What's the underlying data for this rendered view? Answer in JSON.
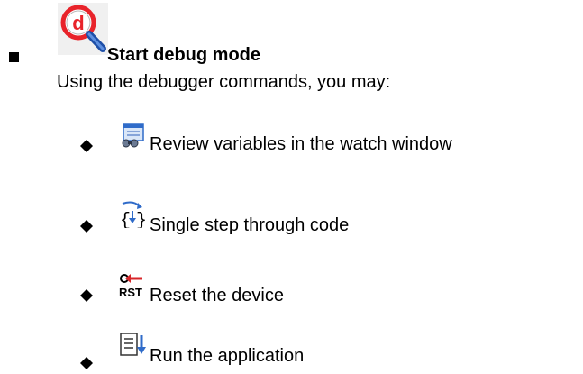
{
  "heading": "Start debug mode",
  "intro": "Using the debugger commands, you may:",
  "items": [
    {
      "label": "Review variables in the watch window",
      "icon": "watch-window-icon"
    },
    {
      "label": "Single step through code",
      "icon": "step-into-icon"
    },
    {
      "label": "Reset the device",
      "icon": "reset-icon"
    },
    {
      "label": "Run the application",
      "icon": "run-icon"
    }
  ],
  "icon_text": {
    "debug": "d",
    "reset": "RST"
  },
  "colors": {
    "debug_red": "#e8232a",
    "magnifier_blue": "#1e4fa8",
    "icon_blue": "#2f6bc9",
    "reset_red": "#d8262a"
  }
}
